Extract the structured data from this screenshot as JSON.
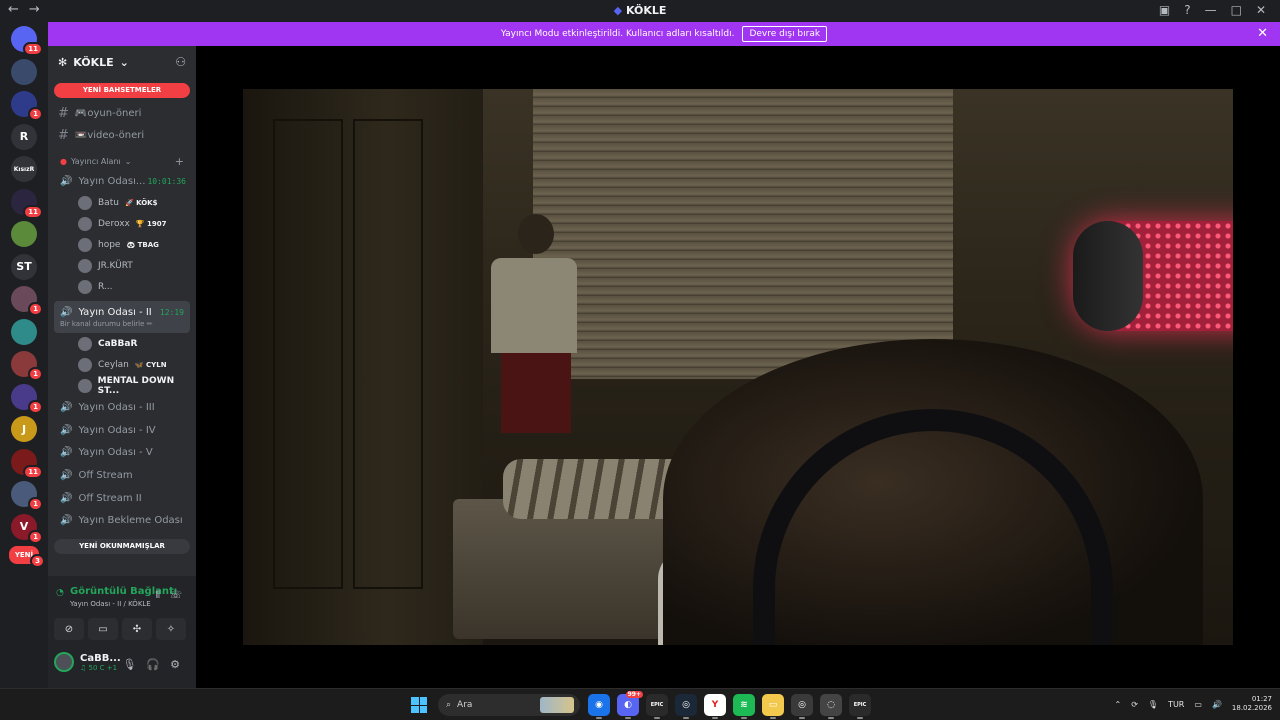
{
  "window": {
    "title": "KÖKLE",
    "back": "←",
    "forward": "→"
  },
  "banner": {
    "message": "Yayıncı Modu etkinleştirildi. Kullanıcı adları kısaltıldı.",
    "button": "Devre dışı bırak"
  },
  "guilds": [
    {
      "label": "",
      "badge": "11",
      "color": "#5865f2"
    },
    {
      "label": "",
      "badge": "",
      "color": "#3a4a6b"
    },
    {
      "label": "",
      "badge": "1",
      "color": "#2e3b8a"
    },
    {
      "label": "R",
      "badge": "",
      "color": "#313338"
    },
    {
      "label": "KısızR",
      "badge": "",
      "color": "#313338"
    },
    {
      "label": "",
      "badge": "11",
      "color": "#2b2540"
    },
    {
      "label": "",
      "badge": "",
      "color": "#5a8a3a"
    },
    {
      "label": "ST",
      "badge": "",
      "color": "#313338"
    },
    {
      "label": "",
      "badge": "1",
      "color": "#6a4a5a"
    },
    {
      "label": "",
      "badge": "",
      "color": "#2f8a8a"
    },
    {
      "label": "",
      "badge": "1",
      "color": "#8a3a3a"
    },
    {
      "label": "",
      "badge": "1",
      "color": "#4a3a8a"
    },
    {
      "label": "J",
      "badge": "",
      "color": "#c99a1a"
    },
    {
      "label": "",
      "badge": "11",
      "color": "#7a1a1a"
    },
    {
      "label": "",
      "badge": "1",
      "color": "#4a5a7a"
    },
    {
      "label": "V",
      "badge": "1",
      "color": "#8a1a2a"
    },
    {
      "label": "YENİ",
      "badge": "3",
      "color": "#f23f43"
    }
  ],
  "server": {
    "name": "KÖKLE",
    "new_mentions": "YENİ BAHSETMELER",
    "new_unreads": "YENİ OKUNMAMIŞLAR"
  },
  "text_channels": [
    {
      "name": "🎮oyun-öneri"
    },
    {
      "name": "📼video-öneri"
    }
  ],
  "category": {
    "name": "Yayıncı Alanı",
    "add": "+"
  },
  "voice1": {
    "name": "Yayın Odası...",
    "time": "10:01:36",
    "users": [
      {
        "name": "Batu",
        "tag": "🚀 KÖK$",
        "bright": false
      },
      {
        "name": "Deroxx",
        "tag": "🏆 1907",
        "bright": false
      },
      {
        "name": "hope",
        "tag": "🐼 TBAG",
        "bright": false
      },
      {
        "name": "JR.KÜRT",
        "tag": "",
        "bright": false
      },
      {
        "name": "R...",
        "tag": "",
        "bright": false
      }
    ]
  },
  "voice2": {
    "name": "Yayın Odası - II",
    "time": "12:19",
    "status": "Bir kanal durumu belirle ✏",
    "users": [
      {
        "name": "CaBBaR",
        "tag": "",
        "bright": true
      },
      {
        "name": "Ceylan",
        "tag": "🦋 CYLN",
        "bright": false
      },
      {
        "name": "MENTAL DOWN ST...",
        "tag": "",
        "bright": true
      }
    ]
  },
  "other_voice": [
    {
      "name": "Yayın Odası - III"
    },
    {
      "name": "Yayın Odası - IV"
    },
    {
      "name": "Yayın Odası - V"
    },
    {
      "name": "Off Stream"
    },
    {
      "name": "Off Stream II"
    },
    {
      "name": "Yayın Bekleme Odası"
    }
  ],
  "voice_panel": {
    "status": "Görüntülü Bağlantı",
    "channel": "Yayın Odası - II / KÖKLE"
  },
  "user_panel": {
    "name": "CaBB...",
    "status": "♫ 50 C +1"
  },
  "taskbar": {
    "search_placeholder": "Ara",
    "apps": [
      {
        "icon": "chrome-icon",
        "glyph": "◉",
        "color": "#1a73e8",
        "badge": ""
      },
      {
        "icon": "discord-icon",
        "glyph": "◐",
        "color": "#5865f2",
        "badge": "99+"
      },
      {
        "icon": "epic-icon",
        "glyph": "EPIC",
        "color": "#2a2a2a",
        "badge": ""
      },
      {
        "icon": "steam-icon",
        "glyph": "◎",
        "color": "#1b2838",
        "badge": ""
      },
      {
        "icon": "yandex-icon",
        "glyph": "Y",
        "color": "#ffffff",
        "badge": ""
      },
      {
        "icon": "spotify-icon",
        "glyph": "≋",
        "color": "#1db954",
        "badge": ""
      },
      {
        "icon": "folder-icon",
        "glyph": "▭",
        "color": "#f2c94c",
        "badge": ""
      },
      {
        "icon": "steam2-icon",
        "glyph": "◎",
        "color": "#1b2838",
        "badge": ""
      },
      {
        "icon": "game-icon",
        "glyph": "◌",
        "color": "#444444",
        "badge": ""
      },
      {
        "icon": "epic2-icon",
        "glyph": "EPIC",
        "color": "#2a2a2a",
        "badge": ""
      }
    ],
    "lang": "TUR",
    "time": "01:27",
    "date": "18.02.2026"
  }
}
